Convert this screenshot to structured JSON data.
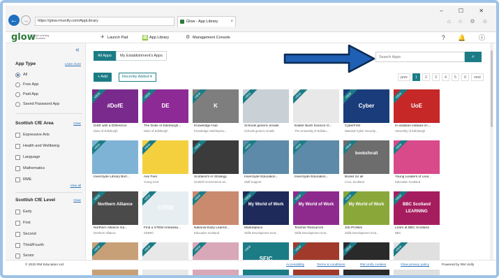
{
  "browser": {
    "url": "https://glow.rmunify.com/AppLibrary",
    "tab_title": "Glow - App Library",
    "tab_close": "×",
    "back": "←",
    "forward": "→",
    "window_controls": "– ☐ ✕",
    "toolbar_icons": "⌂ ☆ ⚙ ☺"
  },
  "header": {
    "logo": "glow",
    "logo_sub": "Digital Learning for Scotland",
    "nav": [
      {
        "label": "Launch Pad",
        "icon": "launch-icon"
      },
      {
        "label": "App Library",
        "icon": "library-icon"
      },
      {
        "label": "Management Console",
        "icon": "management-icon"
      }
    ],
    "icons": "? 🔔 ⓘ"
  },
  "sidebar": {
    "collapse": "«",
    "app_type": {
      "title": "App Type",
      "learn_more": "Learn more",
      "options": [
        "All",
        "Free App",
        "Paid App",
        "Saved Password App"
      ],
      "selected": "All"
    },
    "cfe_area": {
      "title": "Scottish CfE Area",
      "clear": "Clear",
      "options": [
        "Expressive Arts",
        "Health and Wellbeing",
        "Language",
        "Mathematics",
        "RME"
      ],
      "view_all": "View all"
    },
    "cfe_level": {
      "title": "Scottish CfE Level",
      "clear": "Clear",
      "options": [
        "Early",
        "First",
        "Second",
        "Third/Fourth",
        "Senior"
      ]
    }
  },
  "main": {
    "tabs": [
      "All Apps",
      "My Establishment's Apps"
    ],
    "active_tab": "All Apps",
    "add_label": "+ Add",
    "sort_label": "Recently Added ▾",
    "search_placeholder": "Search Apps",
    "search_icon": "search-icon",
    "pager": [
      "prev",
      "1",
      "2",
      "3",
      "4",
      "5",
      "6",
      "next"
    ],
    "current_page": "1",
    "ribbon": "VIEW",
    "apps": [
      {
        "name": "DofE with a Difference",
        "org": "Duke of Edinburgh",
        "color": "#7a2a8c",
        "art": "#DofE"
      },
      {
        "name": "The Duke of Edinburgh...",
        "org": "Duke of Edinburgh",
        "color": "#8e2a96",
        "art": "DE"
      },
      {
        "name": "Knowledge Hub",
        "org": "Knowledge Hub/Improv...",
        "color": "#7e7e7e",
        "art": "K"
      },
      {
        "name": "Schools generic emails",
        "org": "Schools generic emails",
        "color": "#c9d0d6",
        "art": ""
      },
      {
        "name": "Easter Bush Science O...",
        "org": "The University of Edinbu...",
        "color": "#e8e8e8",
        "art": ""
      },
      {
        "name": "CyberFirst",
        "org": "National Cyber Security...",
        "color": "#1b3c7a",
        "art": "Cyber"
      },
      {
        "name": "In isolation instead of i...",
        "org": "University of Edinburgh",
        "color": "#c62828",
        "art": "UoE"
      },
      {
        "name": "Inverclyde Library Borr...",
        "org": "",
        "color": "#7fb3d5",
        "art": ""
      },
      {
        "name": "Ave Feel",
        "org": "Young Scot",
        "color": "#f4d03f",
        "art": ""
      },
      {
        "name": "Scotland's AI Strategy",
        "org": "Scottish Government an...",
        "color": "#3b3b3b",
        "art": ""
      },
      {
        "name": "Inverclyde Education...",
        "org": "Staff Support",
        "color": "#5d8aa8",
        "art": ""
      },
      {
        "name": "Inverclyde Education...",
        "org": "",
        "color": "#5d8aa8",
        "art": ""
      },
      {
        "name": "Books for all",
        "org": "CALL Scotland",
        "color": "#6d6d6d",
        "art": "booksforall"
      },
      {
        "name": "Young Leaders of Lear...",
        "org": "Education Scotland",
        "color": "#d84a8a",
        "art": ""
      },
      {
        "name": "Northern Alliance Ga...",
        "org": "Northern Alliance",
        "color": "#4a4a4a",
        "art": "Northern Alliance"
      },
      {
        "name": "Find a STEM Ambassa...",
        "org": "SSERC",
        "color": "#e6eef2",
        "art": "STEM"
      },
      {
        "name": "National Early Learnin...",
        "org": "Education Scotland",
        "color": "#c98a6e",
        "art": ""
      },
      {
        "name": "Marketplace",
        "org": "Skills Development Scot...",
        "color": "#1e2a5a",
        "art": "My World of Work"
      },
      {
        "name": "Teacher Resources",
        "org": "Skills Development Scot...",
        "color": "#8e2a8e",
        "art": "My World of Work"
      },
      {
        "name": "Job Profiles",
        "org": "Skills Development Scot...",
        "color": "#8aa83a",
        "art": "My World of Work"
      },
      {
        "name": "Learn at BBC Scotland",
        "org": "BBC",
        "color": "#a51d5e",
        "art": "BBC Scotland LEARNING"
      },
      {
        "name": "",
        "org": "",
        "color": "#c8a078",
        "art": ""
      },
      {
        "name": "",
        "org": "",
        "color": "#e8e8e8",
        "art": ""
      },
      {
        "name": "",
        "org": "",
        "color": "#d9a8b8",
        "art": ""
      },
      {
        "name": "",
        "org": "",
        "color": "#1c7c86",
        "art": "SEIC"
      },
      {
        "name": "",
        "org": "",
        "color": "#a13a2a",
        "art": ""
      },
      {
        "name": "",
        "org": "",
        "color": "#2a2a2a",
        "art": ""
      },
      {
        "name": "",
        "org": "",
        "color": "#e0e0e0",
        "art": ""
      }
    ]
  },
  "footer": {
    "copyright": "© 2020 RM Education Ltd",
    "links": [
      "Accessibility",
      "Terms & conditions",
      "RM Unify cookies",
      "Glow privacy policy"
    ],
    "powered_by": "Powered by RM Unify"
  }
}
